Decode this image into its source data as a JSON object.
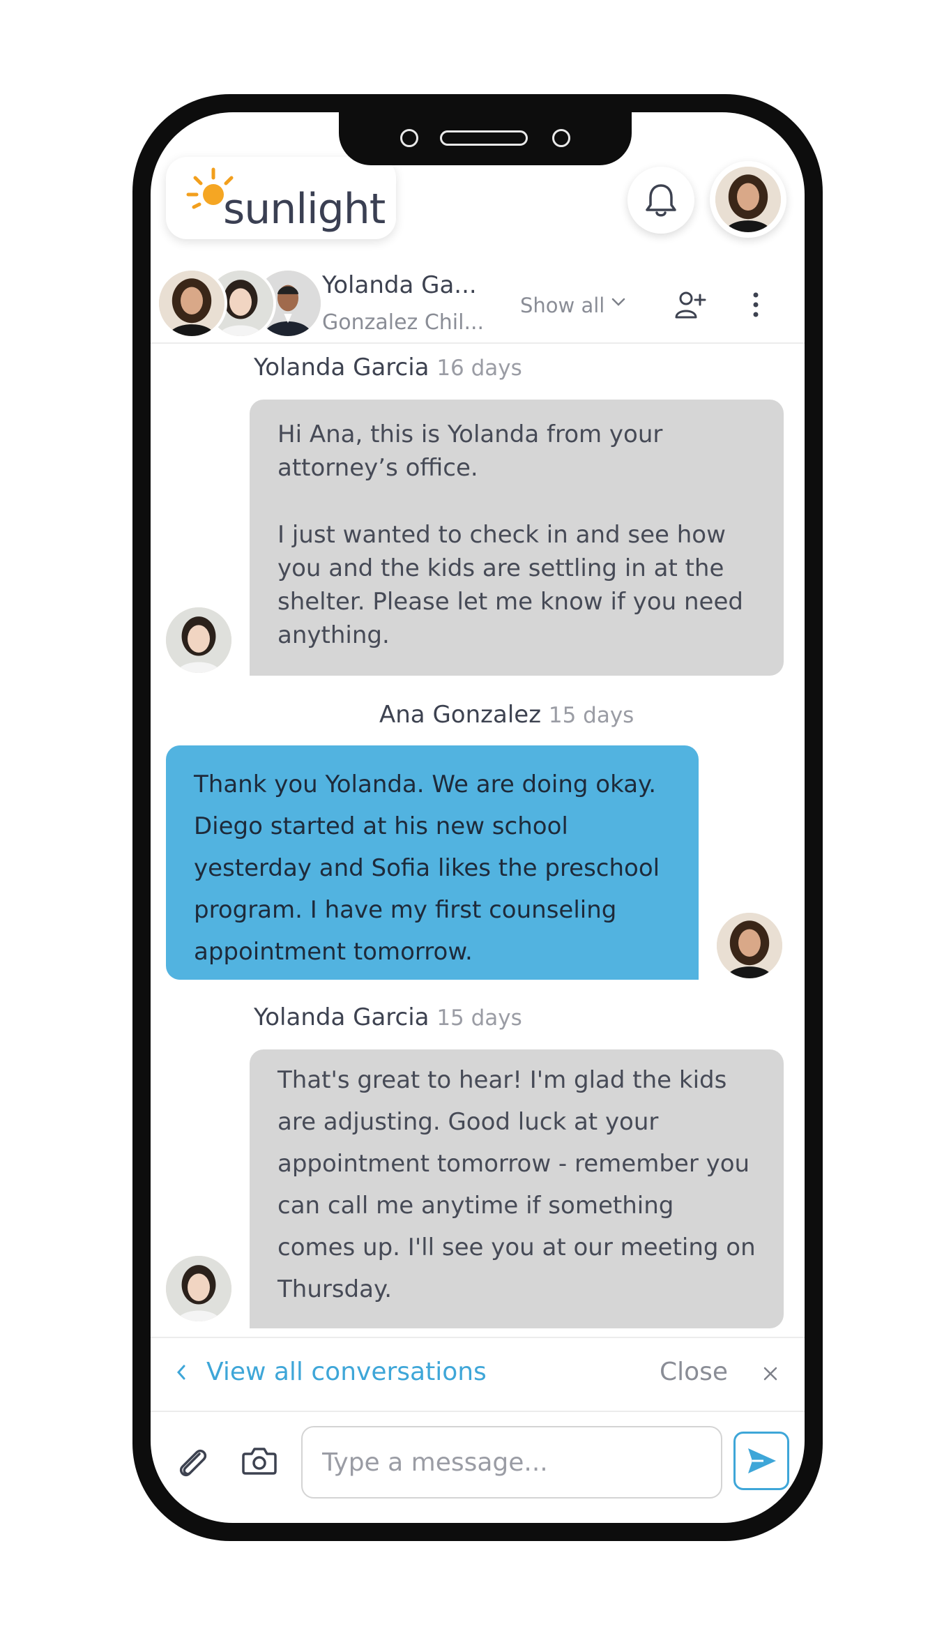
{
  "app": {
    "brand": "sunlight",
    "accent_color": "#3ea6d8",
    "brand_sun_color": "#f5a623"
  },
  "header": {
    "bell_icon": "bell-icon",
    "profile_avatar": "user-avatar"
  },
  "conversation": {
    "title": "Yolanda Ga...",
    "subtitle": "Gonzalez Chil...",
    "show_all_label": "Show all",
    "add_participant_icon": "add-user-icon",
    "more_icon": "more-vertical-icon"
  },
  "messages": [
    {
      "sender": "Yolanda Garcia",
      "time": "16 days",
      "direction": "incoming",
      "paragraphs": [
        "Hi Ana, this is Yolanda from your attorney’s office.",
        "I just wanted to check in and see how you and the kids are settling in at the shelter. Please let me know if you need anything."
      ]
    },
    {
      "sender": "Ana Gonzalez",
      "time": "15 days",
      "direction": "outgoing",
      "paragraphs": [
        "Thank you Yolanda. We are doing okay. Diego started at his new school yesterday and Sofia likes the preschool program. I have my first counseling appointment tomorrow."
      ]
    },
    {
      "sender": "Yolanda Garcia",
      "time": "15 days",
      "direction": "incoming",
      "paragraphs": [
        "That's great to hear! I'm glad the kids are adjusting. Good luck at your appointment tomorrow - remember you can call me anytime if something comes up. I'll see you at our meeting on Thursday."
      ]
    }
  ],
  "footer": {
    "view_all_label": "View all conversations",
    "close_label": "Close",
    "input_placeholder": "Type a message...",
    "input_value": ""
  }
}
